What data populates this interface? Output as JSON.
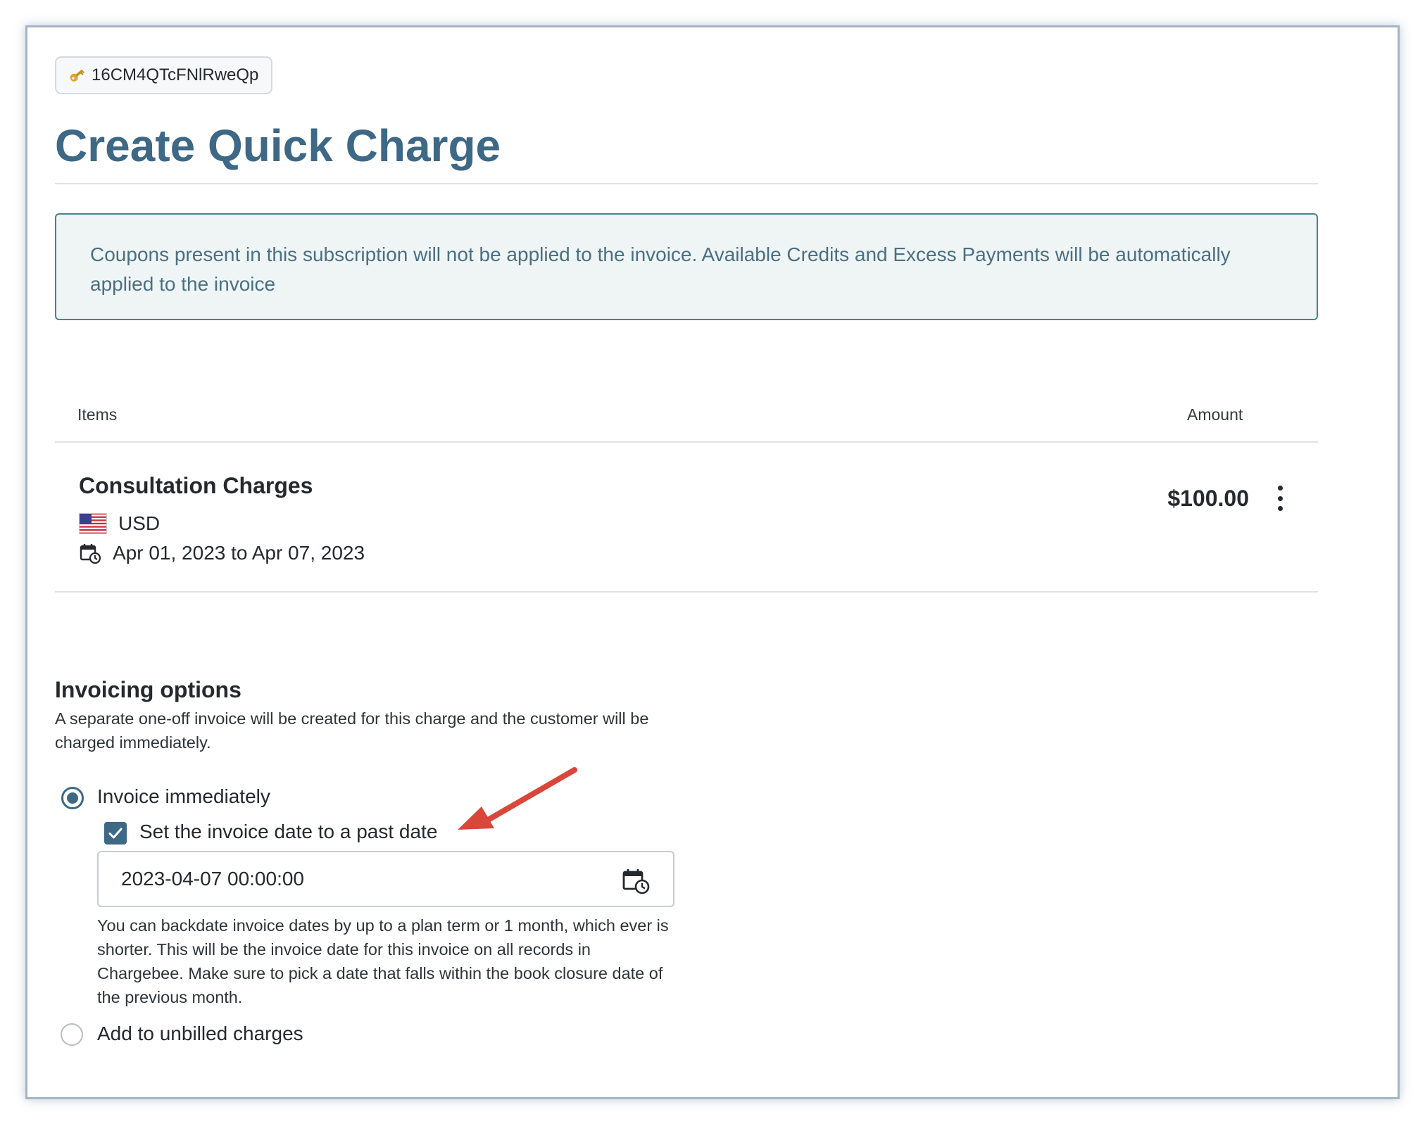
{
  "header": {
    "record_id": "16CM4QTcFNlRweQp",
    "title": "Create Quick Charge"
  },
  "notice": {
    "text": "Coupons present in this subscription will not be applied to the invoice. Available Credits and Excess Payments will be automatically applied to the invoice"
  },
  "items_table": {
    "col_items": "Items",
    "col_amount": "Amount",
    "rows": [
      {
        "name": "Consultation Charges",
        "currency": "USD",
        "period": "Apr 01, 2023 to Apr 07, 2023",
        "amount": "$100.00"
      }
    ]
  },
  "invoicing": {
    "title": "Invoicing options",
    "description": "A separate one-off invoice will be created for this charge and the customer will be charged immediately.",
    "option_immediate": "Invoice immediately",
    "option_immediate_selected": true,
    "backdate_label": "Set the invoice date to a past date",
    "backdate_checked": true,
    "date_value": "2023-04-07 00:00:00",
    "help": "You can backdate invoice dates by up to a plan term or 1 month, which ever is shorter. This will be the invoice date for this invoice on all records in Chargebee. Make sure to pick a date that falls within the book closure date of the previous month.",
    "option_unbilled": "Add to unbilled charges",
    "option_unbilled_selected": false
  },
  "colors": {
    "accent": "#3d6886",
    "notice_bg": "#eff5f5",
    "notice_border": "#4f7e95",
    "annotation_arrow": "#d9473a"
  },
  "icons": [
    "key-icon",
    "flag-us-icon",
    "calendar-clock-icon",
    "more-vertical-icon",
    "check-icon"
  ]
}
